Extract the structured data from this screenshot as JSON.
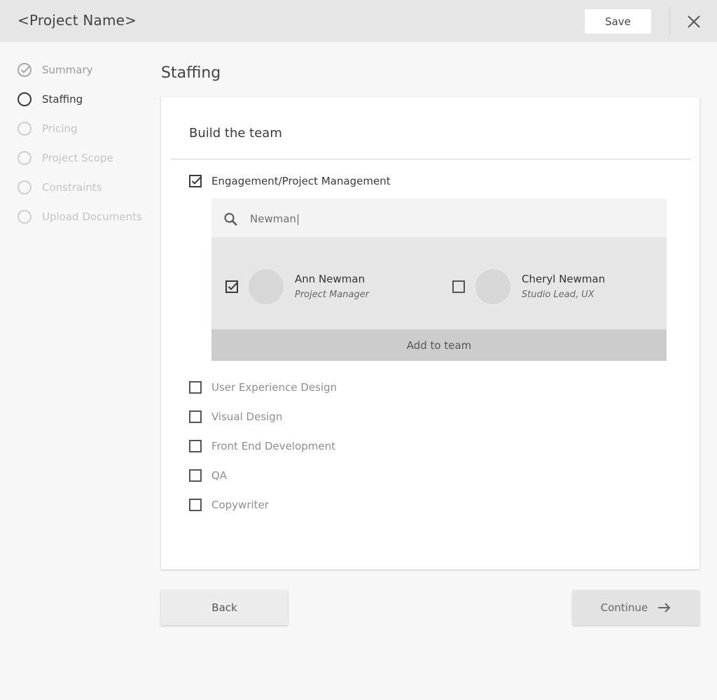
{
  "header": {
    "title": "<Project Name>",
    "save_label": "Save",
    "close_icon": "close-icon"
  },
  "sidebar": {
    "steps": [
      {
        "label": "Summary",
        "status": "done"
      },
      {
        "label": "Staffing",
        "status": "current"
      },
      {
        "label": "Pricing",
        "status": "future"
      },
      {
        "label": "Project Scope",
        "status": "future"
      },
      {
        "label": "Constraints",
        "status": "future"
      },
      {
        "label": "Upload Documents",
        "status": "future"
      }
    ]
  },
  "main": {
    "heading": "Staffing",
    "card": {
      "title": "Build the team",
      "categories": [
        {
          "label": "Engagement/Project Management",
          "checked": true
        },
        {
          "label": "User Experience Design",
          "checked": false
        },
        {
          "label": "Visual Design",
          "checked": false
        },
        {
          "label": "Front End Development",
          "checked": false
        },
        {
          "label": "QA",
          "checked": false
        },
        {
          "label": "Copywriter",
          "checked": false
        }
      ],
      "search": {
        "value": "Newman|",
        "icon": "search-icon"
      },
      "results": [
        {
          "name": "Ann Newman",
          "role": "Project Manager",
          "checked": true
        },
        {
          "name": "Cheryl Newman",
          "role": "Studio Lead, UX",
          "checked": false
        }
      ],
      "add_to_team_label": "Add to team"
    }
  },
  "footer": {
    "back_label": "Back",
    "continue_label": "Continue"
  },
  "colors": {
    "header_bg": "#e6e6e6",
    "page_bg": "#f7f7f7",
    "results_bg": "#e6e6e6",
    "add_button_bg": "#cccccc"
  }
}
